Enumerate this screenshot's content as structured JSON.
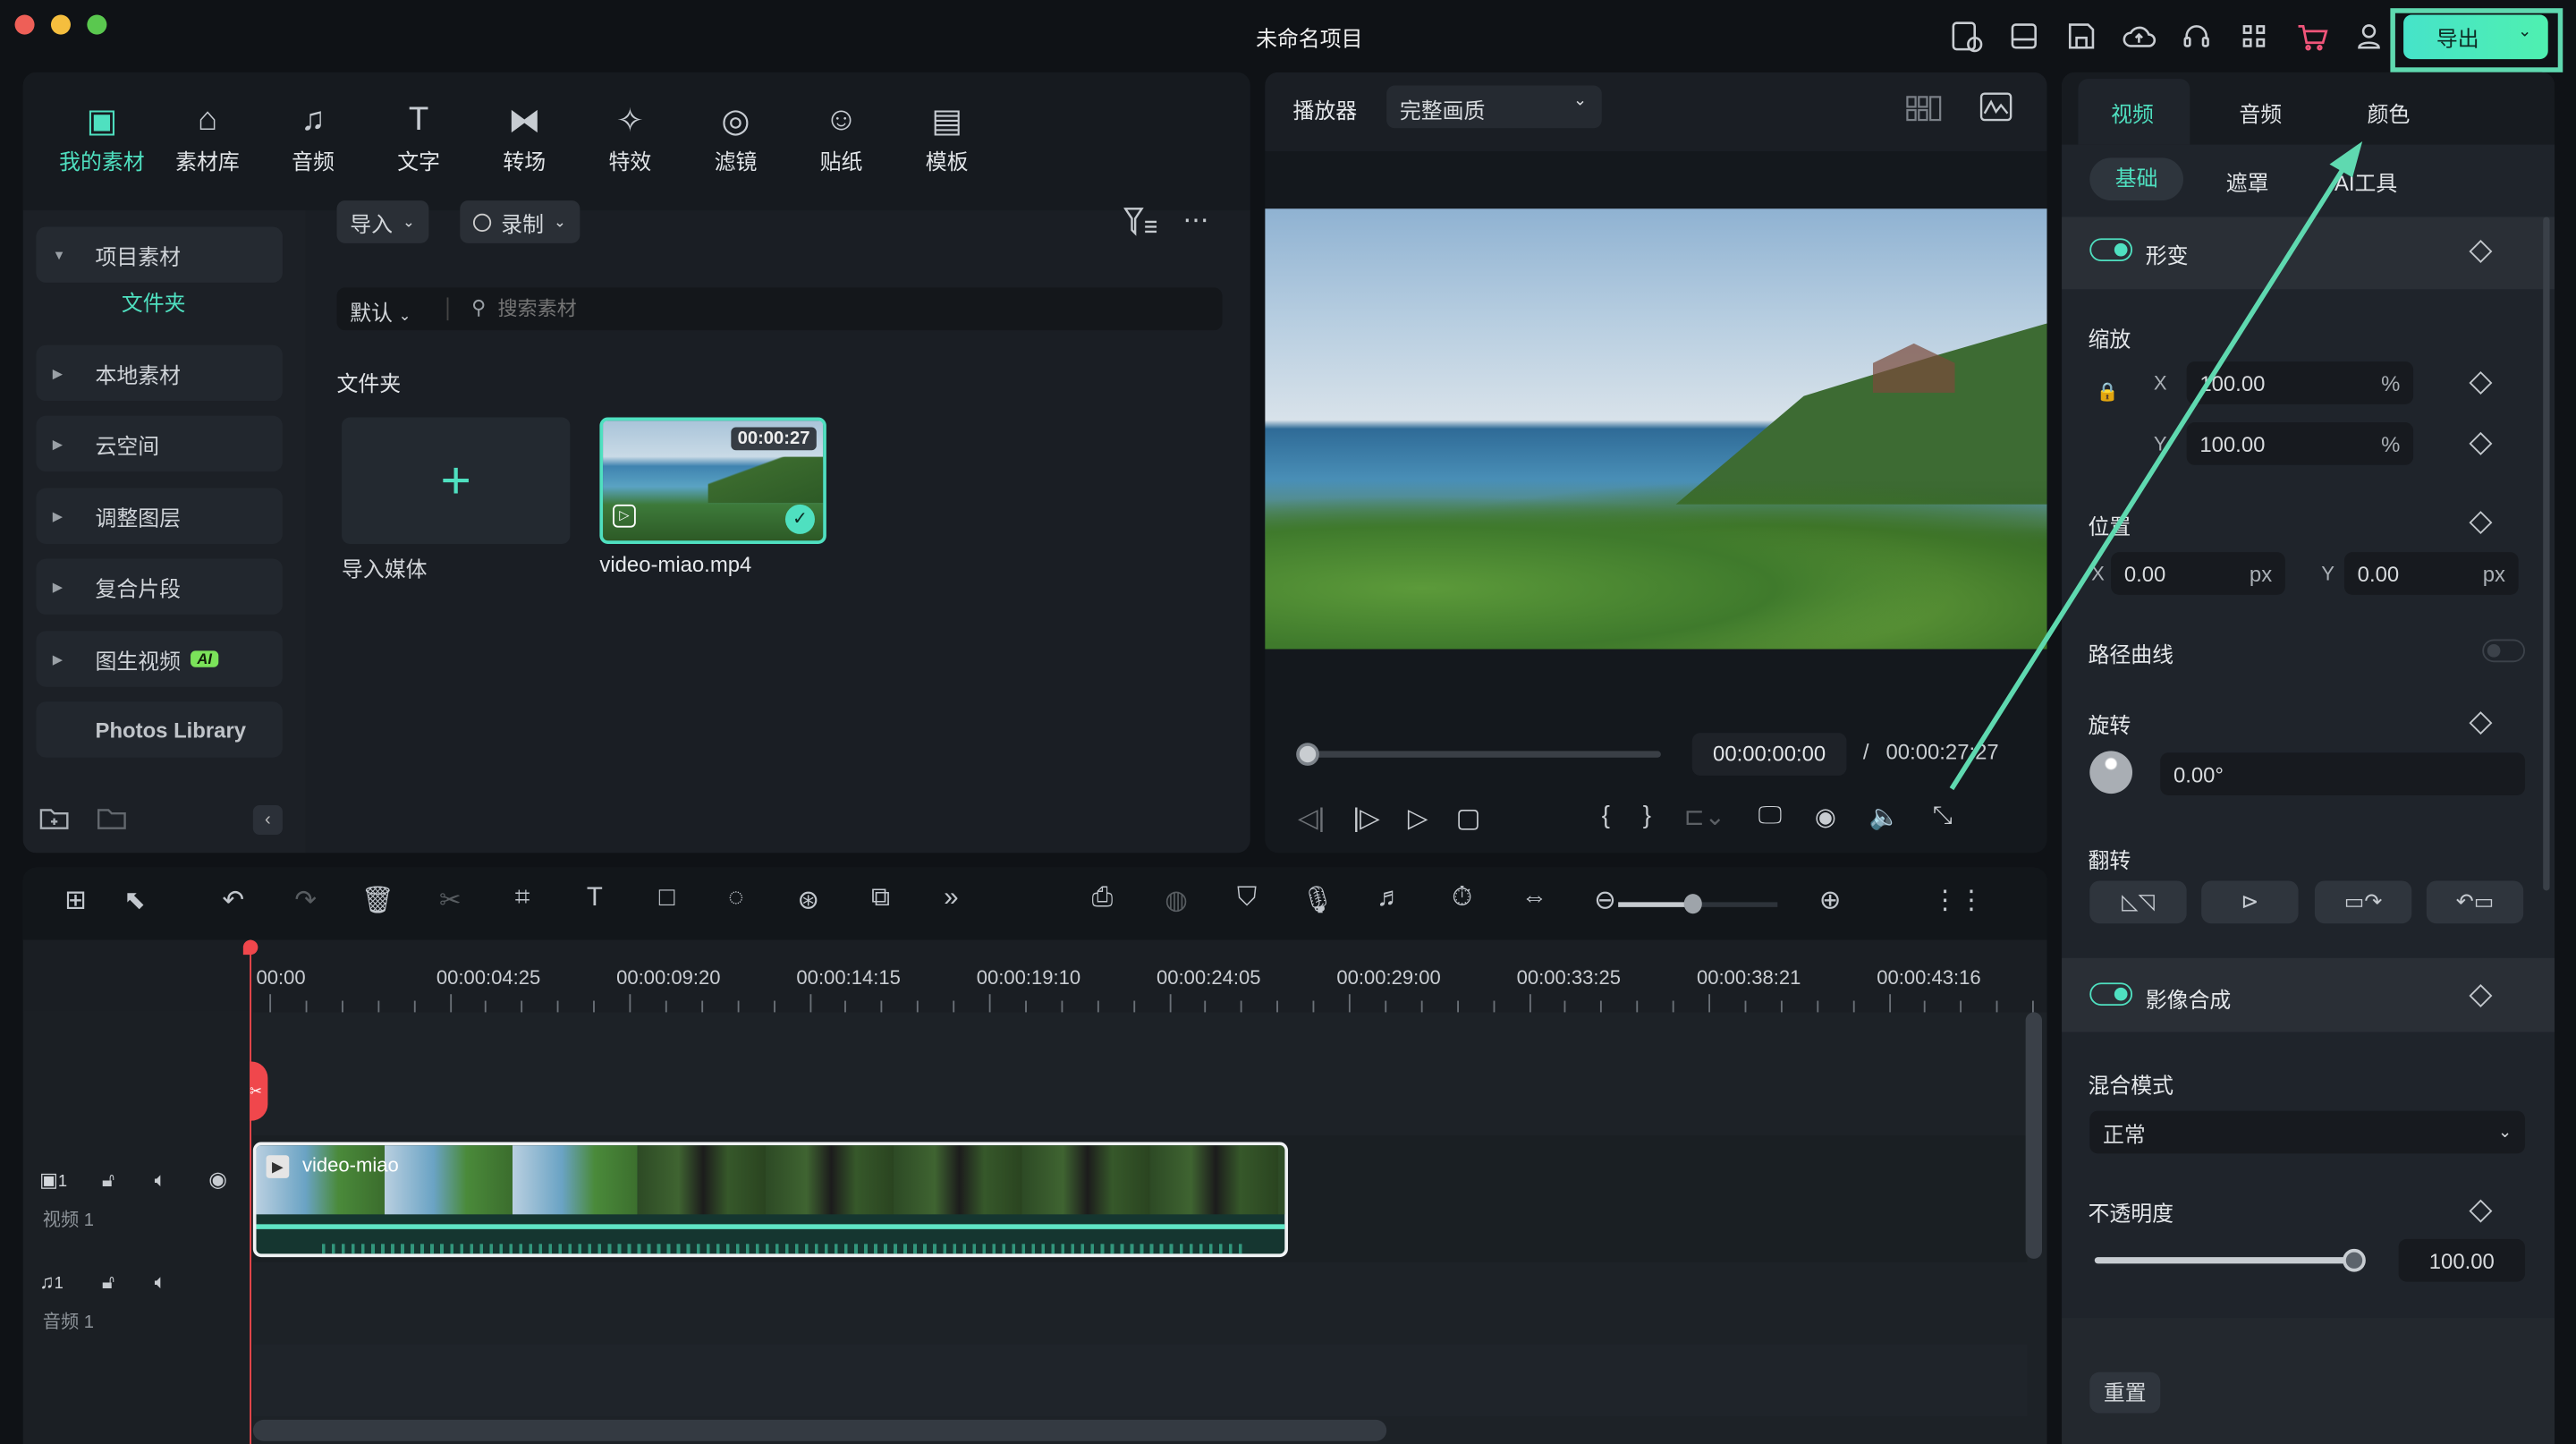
{
  "window": {
    "title": "未命名项目",
    "export_label": "导出"
  },
  "titlebar_icons": [
    "task-icon",
    "layout-icon",
    "save-icon",
    "cloud-upload-icon",
    "headset-icon",
    "apps-grid-icon",
    "cart-icon",
    "user-icon"
  ],
  "media_tabs": [
    {
      "label": "我的素材",
      "icon": "my-media-icon",
      "active": true
    },
    {
      "label": "素材库",
      "icon": "stock-icon"
    },
    {
      "label": "音频",
      "icon": "music-icon"
    },
    {
      "label": "文字",
      "icon": "text-icon"
    },
    {
      "label": "转场",
      "icon": "transition-icon"
    },
    {
      "label": "特效",
      "icon": "effects-icon"
    },
    {
      "label": "滤镜",
      "icon": "filter-icon"
    },
    {
      "label": "贴纸",
      "icon": "sticker-icon"
    },
    {
      "label": "模板",
      "icon": "template-icon"
    }
  ],
  "sidebar": {
    "project_media": "项目素材",
    "folder": "文件夹",
    "items": [
      {
        "label": "本地素材"
      },
      {
        "label": "云空间"
      },
      {
        "label": "调整图层"
      },
      {
        "label": "复合片段"
      },
      {
        "label": "图生视频",
        "badge": "AI"
      }
    ],
    "photos_library": "Photos Library"
  },
  "media": {
    "import_label": "导入",
    "record_label": "录制",
    "sort_label": "默认",
    "search_placeholder": "搜索素材",
    "section_title": "文件夹",
    "import_media_label": "导入媒体",
    "clip": {
      "name": "video-miao.mp4",
      "duration": "00:00:27",
      "selected": true
    }
  },
  "player": {
    "label": "播放器",
    "quality": "完整画质",
    "current_time": "00:00:00:00",
    "separator": "/",
    "total_time": "00:00:27:27",
    "progress": 0
  },
  "inspector": {
    "tabs": [
      "视频",
      "音频",
      "颜色"
    ],
    "active_tab": "视频",
    "subtabs": [
      "基础",
      "遮罩",
      "AI工具"
    ],
    "active_subtab": "基础",
    "transform": {
      "label": "形变",
      "enabled": true
    },
    "scale": {
      "label": "缩放",
      "x_label": "X",
      "x": "100.00",
      "y_label": "Y",
      "y": "100.00",
      "unit": "%"
    },
    "position": {
      "label": "位置",
      "x_label": "X",
      "x": "0.00",
      "y_label": "Y",
      "y": "0.00",
      "unit": "px"
    },
    "path_curve": {
      "label": "路径曲线",
      "enabled": false
    },
    "rotate": {
      "label": "旋转",
      "value": "0.00°"
    },
    "flip": {
      "label": "翻转"
    },
    "compositing": {
      "label": "影像合成",
      "enabled": true
    },
    "blend": {
      "label": "混合模式",
      "value": "正常"
    },
    "opacity": {
      "label": "不透明度",
      "value": "100.00",
      "level": 100
    },
    "reset_label": "重置"
  },
  "timeline": {
    "ruler": [
      "00:00",
      "00:00:04:25",
      "00:00:09:20",
      "00:00:14:15",
      "00:00:19:10",
      "00:00:24:05",
      "00:00:29:00",
      "00:00:33:25",
      "00:00:38:21",
      "00:00:43:16"
    ],
    "tracks": [
      {
        "label": "视频 1",
        "num": "1"
      },
      {
        "label": "音频 1",
        "num": "1"
      }
    ],
    "clip_label": "video-miao",
    "zoom_level": 0.5
  },
  "colors": {
    "accent": "#4fe0c0",
    "playhead": "#f0474c",
    "annotation": "#5fd9b0"
  }
}
